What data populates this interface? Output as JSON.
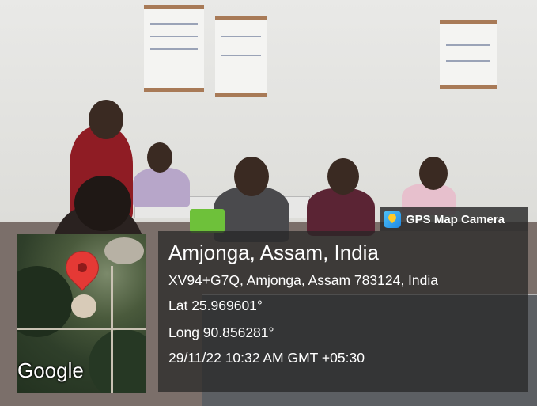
{
  "badge": {
    "app_name": "GPS Map Camera",
    "icon": "gps-map-camera-app-icon"
  },
  "location": {
    "place": "Amjonga, Assam, India",
    "address": "XV94+G7Q, Amjonga, Assam 783124, India",
    "latitude": "Lat 25.969601°",
    "longitude": "Long 90.856281°",
    "timestamp": "29/11/22 10:32 AM GMT +05:30"
  },
  "map": {
    "provider_label": "Google",
    "pin_icon": "map-pin-icon"
  }
}
